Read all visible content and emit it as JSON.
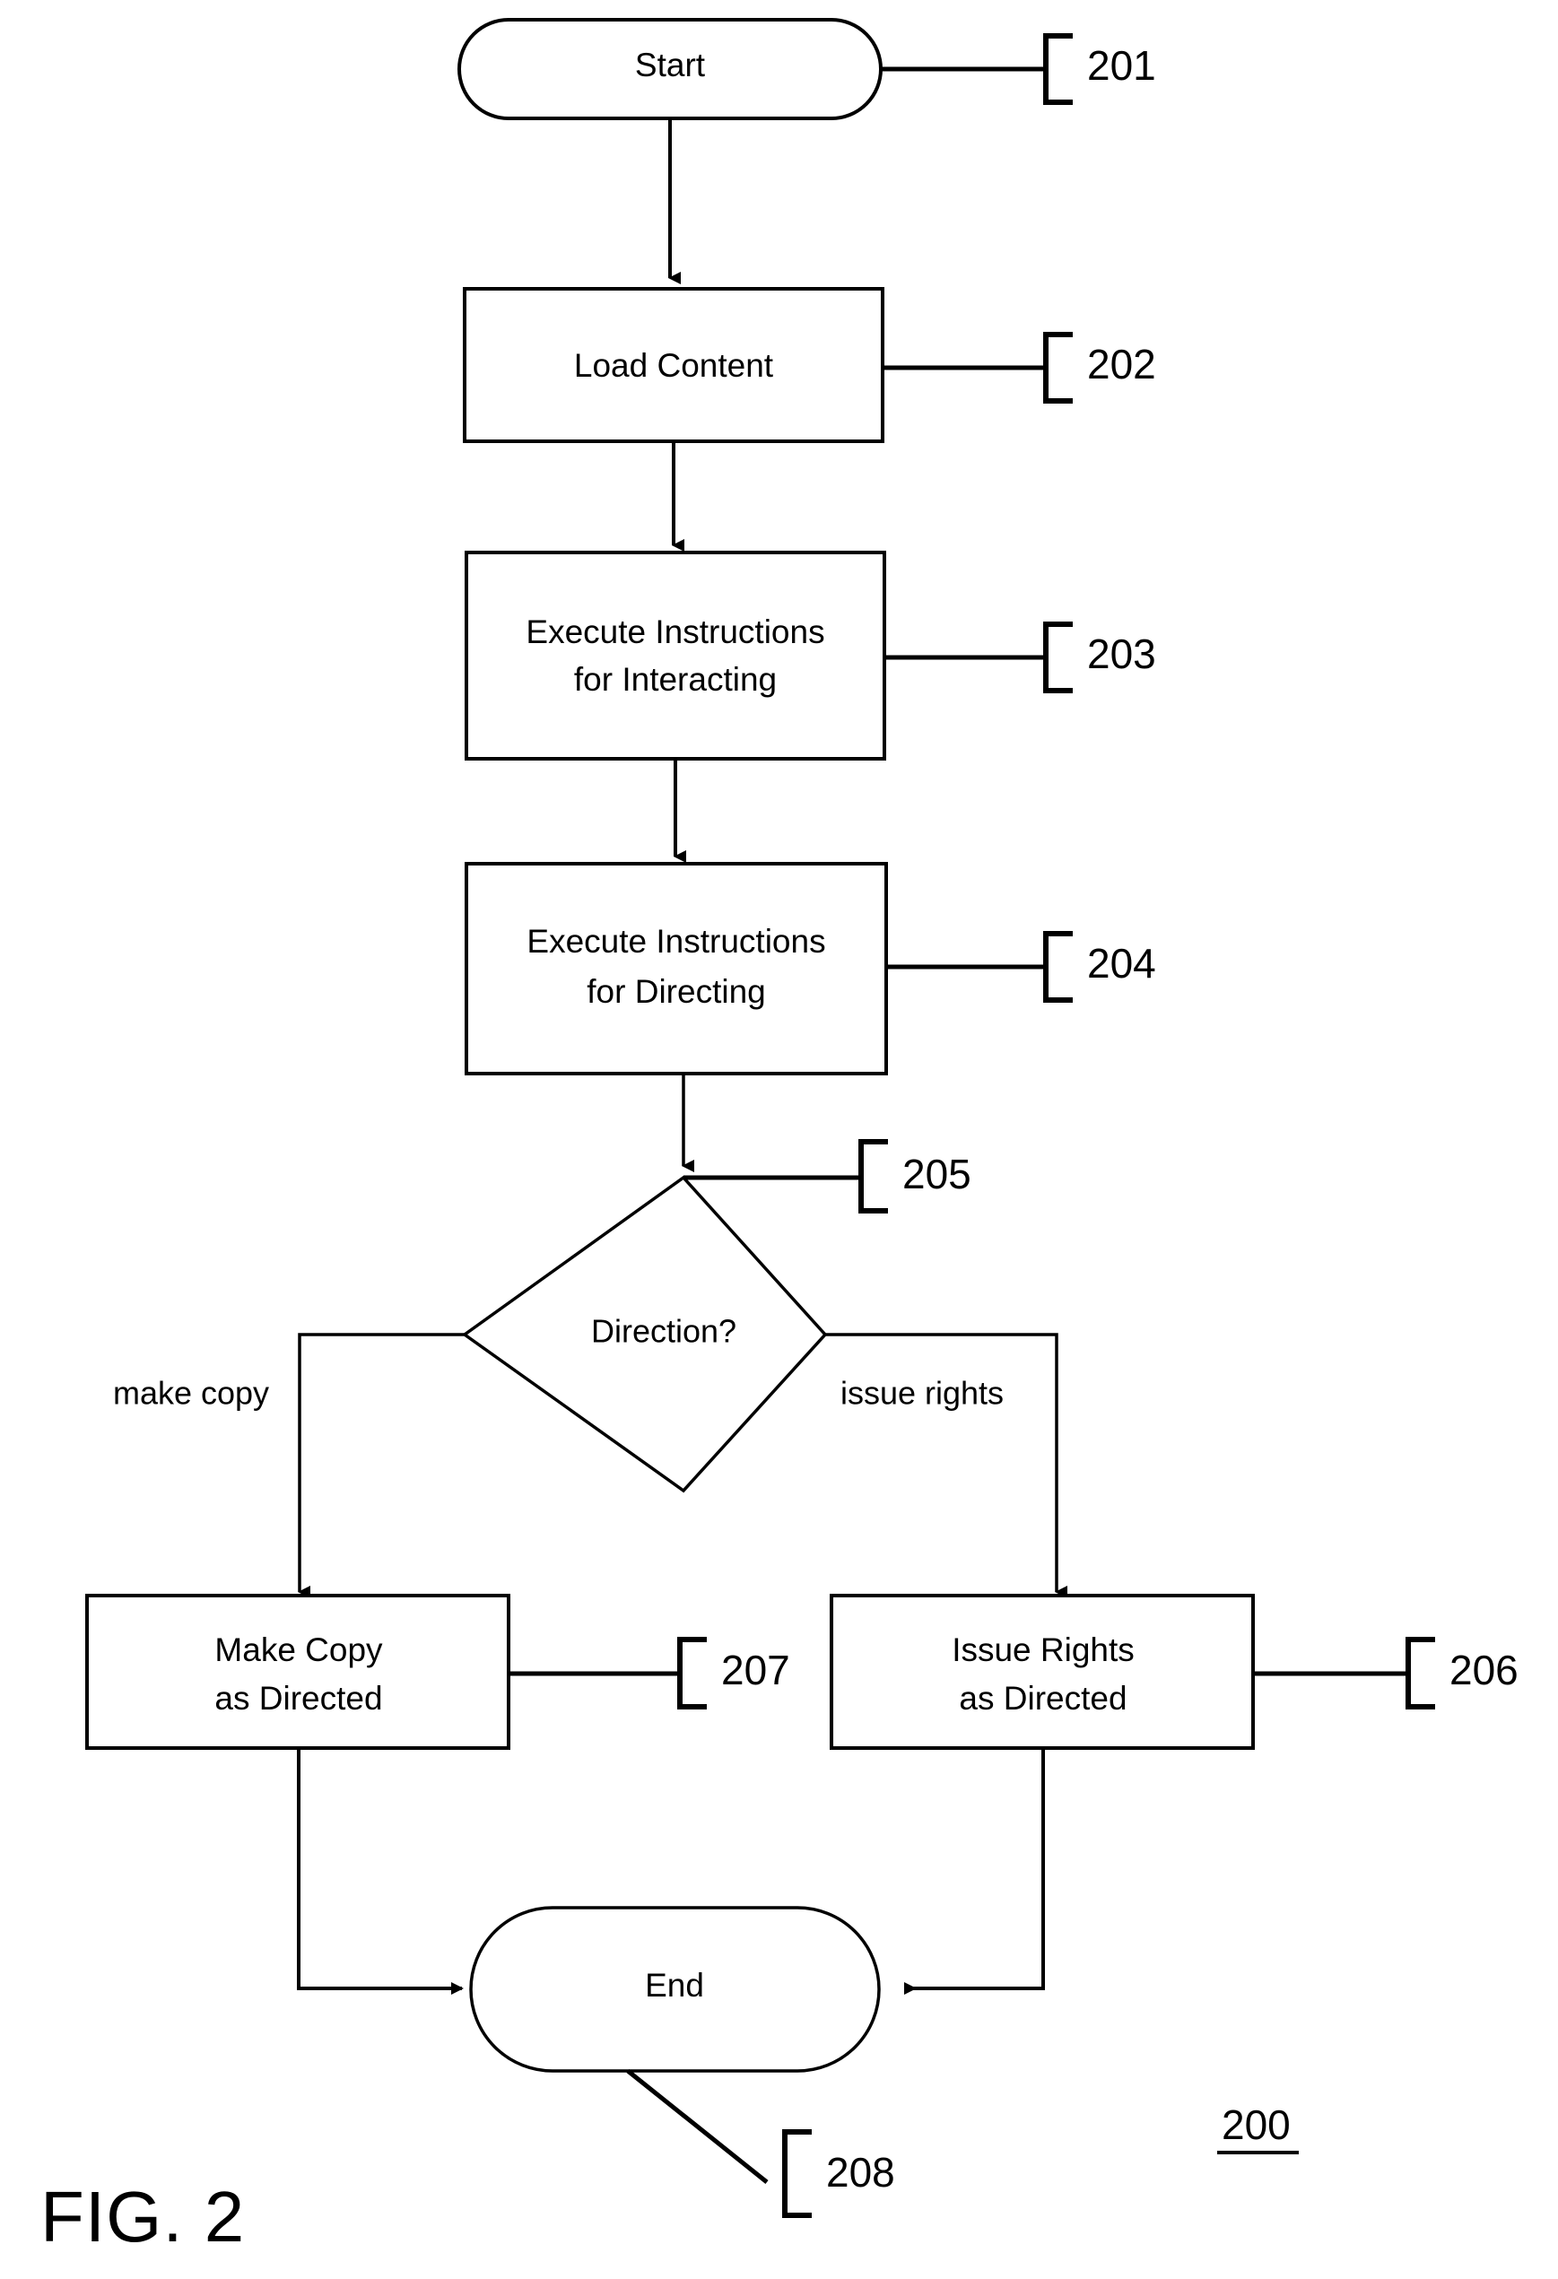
{
  "figure": {
    "caption": "FIG. 2",
    "diagram_number": "200"
  },
  "nodes": {
    "start": {
      "id": "201",
      "label": "Start",
      "shape": "terminator"
    },
    "load_content": {
      "id": "202",
      "label": "Load Content",
      "shape": "process"
    },
    "execute_interacting": {
      "id": "203",
      "label_line1": "Execute Instructions",
      "label_line2": "for Interacting",
      "shape": "process"
    },
    "execute_directing": {
      "id": "204",
      "label_line1": "Execute Instructions",
      "label_line2": "for Directing",
      "shape": "process"
    },
    "decision": {
      "id": "205",
      "label": "Direction?",
      "shape": "decision"
    },
    "make_copy": {
      "id": "207",
      "label_line1": "Make Copy",
      "label_line2": "as Directed",
      "shape": "process"
    },
    "issue_rights": {
      "id": "206",
      "label_line1": "Issue Rights",
      "label_line2": "as Directed",
      "shape": "process"
    },
    "end": {
      "id": "208",
      "label": "End",
      "shape": "terminator"
    }
  },
  "edges": {
    "branch_left_label": "make copy",
    "branch_right_label": "issue rights"
  },
  "colors": {
    "stroke": "#000000",
    "fill": "#ffffff",
    "text": "#000000"
  }
}
